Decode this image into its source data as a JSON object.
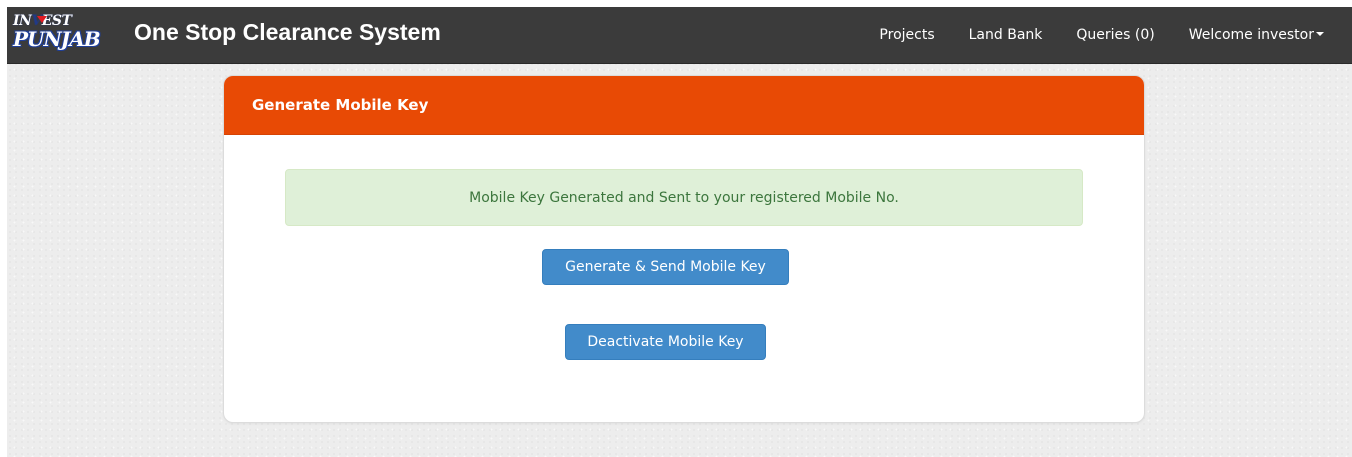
{
  "navbar": {
    "logo_line_1": "IN▾EST",
    "logo_line_2": "PUNJAB",
    "title": "One Stop Clearance System",
    "links": [
      {
        "label": "Projects"
      },
      {
        "label": "Land Bank"
      },
      {
        "label": "Queries (0)"
      }
    ],
    "user_menu_label": "Welcome investor"
  },
  "panel": {
    "title": "Generate Mobile Key",
    "alert_message": "Mobile Key Generated and Sent to your registered Mobile No.",
    "generate_button_label": "Generate & Send Mobile Key",
    "deactivate_button_label": "Deactivate Mobile Key"
  },
  "colors": {
    "navbar_bg": "#3b3b3b",
    "panel_heading_bg": "#e84a05",
    "alert_bg": "#dff0d8",
    "alert_text": "#3c763d",
    "button_primary": "#428bca",
    "page_bg": "#ededed"
  },
  "icons": {
    "logo": "invest-punjab-logo",
    "user_dropdown": "caret-down-icon"
  }
}
